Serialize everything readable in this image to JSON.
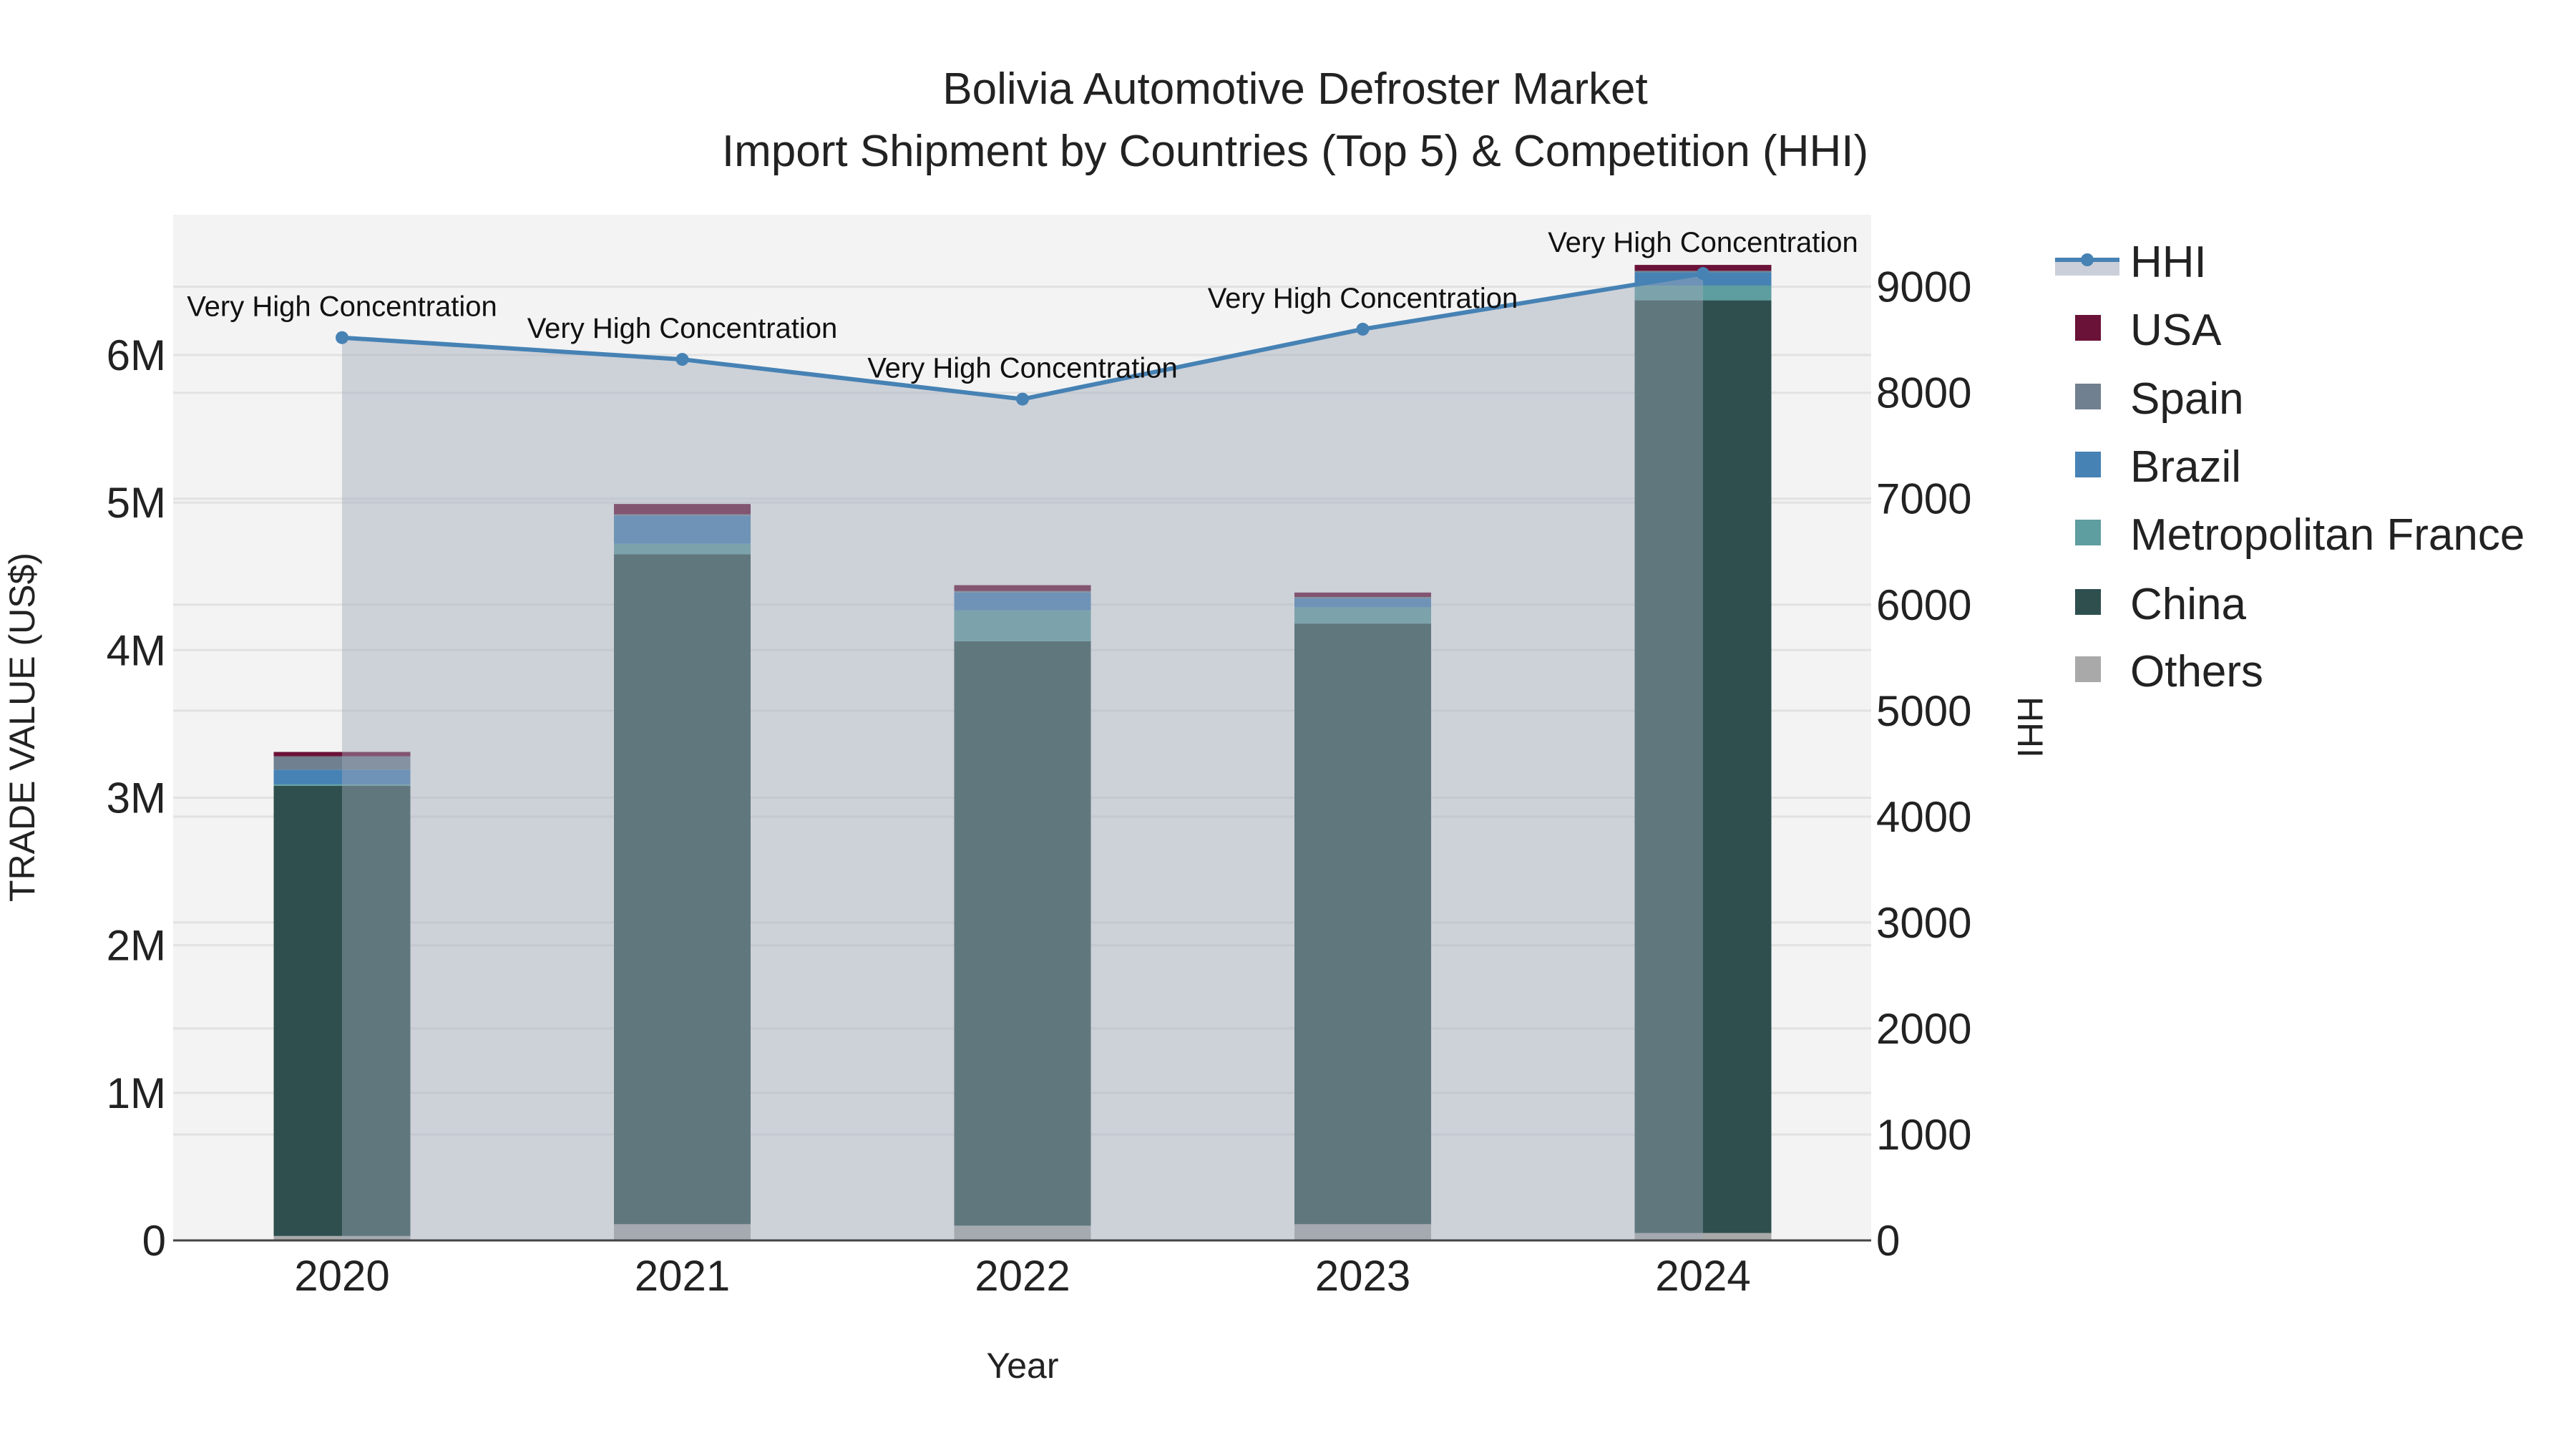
{
  "chart_data": {
    "type": "bar",
    "barmode": "stack",
    "title": "Bolivia Automotive Defroster Market",
    "subtitle": "Import Shipment by Countries (Top 5) & Competition (HHI)",
    "xlabel": "Year",
    "ylabel": "TRADE VALUE (US$)",
    "y2label": "HHI",
    "categories": [
      "2020",
      "2021",
      "2022",
      "2023",
      "2024"
    ],
    "ylim": [
      0,
      6950000
    ],
    "y2lim": [
      0,
      9680
    ],
    "yticks": [
      {
        "v": 0,
        "label": "0"
      },
      {
        "v": 1000000,
        "label": "1M"
      },
      {
        "v": 2000000,
        "label": "2M"
      },
      {
        "v": 3000000,
        "label": "3M"
      },
      {
        "v": 4000000,
        "label": "4M"
      },
      {
        "v": 5000000,
        "label": "5M"
      },
      {
        "v": 6000000,
        "label": "6M"
      }
    ],
    "y2ticks": [
      0,
      1000,
      2000,
      3000,
      4000,
      5000,
      6000,
      7000,
      8000,
      9000
    ],
    "series": [
      {
        "name": "Others",
        "color": "#a9a9a9",
        "values": [
          30000,
          110000,
          100000,
          110000,
          50000
        ]
      },
      {
        "name": "China",
        "color": "#2f4f4f",
        "values": [
          3050000,
          4540000,
          3960000,
          4070000,
          6320000
        ]
      },
      {
        "name": "Metropolitan France",
        "color": "#5f9ea0",
        "values": [
          10000,
          70000,
          210000,
          110000,
          100000
        ]
      },
      {
        "name": "Brazil",
        "color": "#4682b4",
        "values": [
          100000,
          190000,
          120000,
          60000,
          90000
        ]
      },
      {
        "name": "Spain",
        "color": "#708090",
        "values": [
          90000,
          10000,
          10000,
          10000,
          10000
        ]
      },
      {
        "name": "USA",
        "color": "#6b1238",
        "values": [
          30000,
          70000,
          40000,
          30000,
          40000
        ]
      }
    ],
    "hhi": {
      "name": "HHI",
      "color": "#4682b4",
      "values": [
        8520,
        8315,
        7940,
        8600,
        9125
      ],
      "annotations": [
        "Very High Concentration",
        "Very High Concentration",
        "Very High Concentration",
        "Very High Concentration",
        "Very High Concentration"
      ]
    },
    "legend": {
      "placement": "right",
      "items": [
        "HHI",
        "USA",
        "Spain",
        "Brazil",
        "Metropolitan France",
        "China",
        "Others"
      ]
    },
    "grid": true
  }
}
